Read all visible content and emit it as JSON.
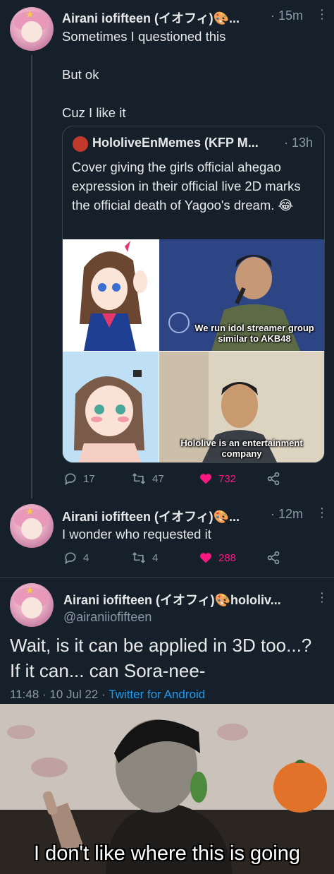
{
  "tweet1": {
    "author": "Airani iofifteen (イオフィ)🎨...",
    "time": "· 15m",
    "more": "⋮",
    "lines": [
      "Sometimes I questioned this",
      "But ok",
      "Cuz I like it"
    ]
  },
  "quote": {
    "author": "HololiveEnMemes (KFP M...",
    "time": "· 13h",
    "text": "Cover giving the girls official ahegao expression in their official live 2D marks the official death of Yagoo's dream. 😂",
    "caption_top": "We run idol streamer group similar to AKB48",
    "caption_bottom": "Hololive is an entertainment company"
  },
  "tweet1_actions": {
    "replies": "17",
    "retweets": "47",
    "likes": "732"
  },
  "tweet2": {
    "author": "Airani iofifteen (イオフィ)🎨...",
    "time": "· 12m",
    "more": "⋮",
    "text": "I wonder who requested it"
  },
  "tweet2_actions": {
    "replies": "4",
    "retweets": "4",
    "likes": "288"
  },
  "tweet3": {
    "author": "Airani iofifteen (イオフィ)🎨hololiv...",
    "handle": "@airaniiofifteen",
    "more": "⋮",
    "text": "Wait, is it can be applied in 3D too...? If it can... can Sora-nee-",
    "timestamp": "11:48 · 10 Jul 22 · ",
    "source": "Twitter for Android"
  },
  "meme": {
    "caption": "I don't like where this is going"
  },
  "colors": {
    "bg": "#15202b",
    "like": "#f91880",
    "link": "#1d9bf0",
    "muted": "#8b98a5"
  },
  "icons": [
    "reply-icon",
    "retweet-icon",
    "heart-icon",
    "share-icon",
    "more-icon"
  ]
}
